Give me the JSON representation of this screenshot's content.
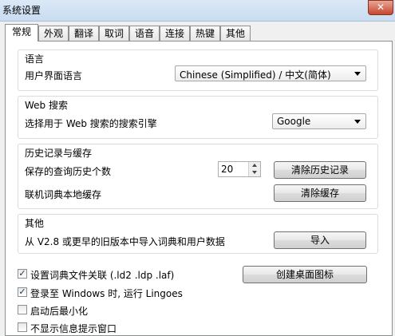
{
  "window": {
    "title": "系统设置",
    "close_label": "✕"
  },
  "tabs": [
    {
      "label": "常规",
      "active": true
    },
    {
      "label": "外观"
    },
    {
      "label": "翻译"
    },
    {
      "label": "取词"
    },
    {
      "label": "语音"
    },
    {
      "label": "连接"
    },
    {
      "label": "热键"
    },
    {
      "label": "其他"
    }
  ],
  "language": {
    "title": "语言",
    "ui_label": "用户界面语言",
    "ui_value": "Chinese (Simplified)  /  中文(简体)"
  },
  "web_search": {
    "title": "Web 搜索",
    "engine_label": "选择用于 Web 搜索的搜索引擎",
    "engine_value": "Google"
  },
  "history": {
    "title": "历史记录与缓存",
    "count_label": "保存的查询历史个数",
    "count_value": "20",
    "clear_history_label": "清除历史记录",
    "cache_label": "联机词典本地缓存",
    "clear_cache_label": "清除缓存"
  },
  "other": {
    "title": "其他",
    "import_desc": "从 V2.8 或更早的旧版本中导入词典和用户数据",
    "import_label": "导入"
  },
  "options": [
    {
      "label": "设置词典文件关联 (.ld2 .ldp .laf)",
      "checked": true
    },
    {
      "label": "登录至 Windows 时, 运行 Lingoes",
      "checked": true
    },
    {
      "label": "启动后最小化",
      "checked": false
    },
    {
      "label": "不显示信息提示窗口",
      "checked": false
    }
  ],
  "create_shortcut_label": "创建桌面图标"
}
